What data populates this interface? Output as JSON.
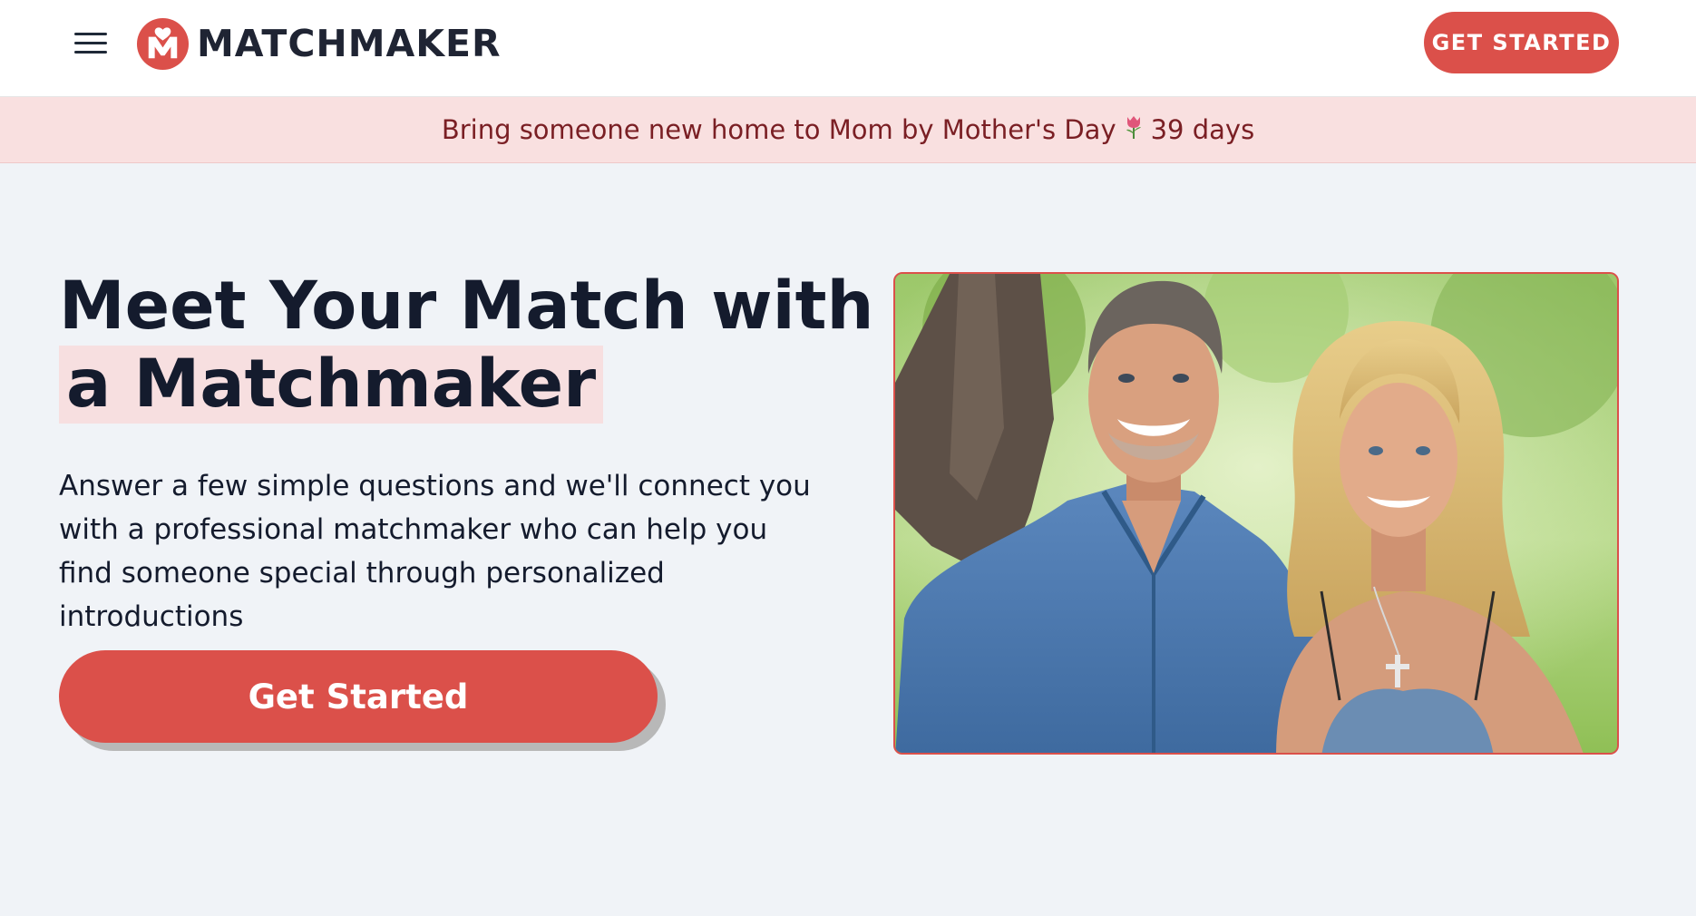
{
  "header": {
    "menu_icon": "hamburger-menu-icon",
    "logo_icon": "matchmaker-heart-m-logo",
    "logo_text": "MATCHMAKER",
    "cta_label": "GET STARTED"
  },
  "banner": {
    "text": "Bring someone new home to Mom by Mother's Day",
    "icon": "tulip-icon",
    "countdown": "39 days"
  },
  "hero": {
    "title_line1": "Meet Your Match with",
    "title_line2": "a Matchmaker",
    "description": "Answer a few simple questions and we'll connect you with a professional matchmaker who can help you find someone special through personalized introductions",
    "cta_label": "Get Started",
    "image_subject": "smiling couple outdoors"
  },
  "colors": {
    "accent": "#db504a",
    "banner_bg": "#f9e0e0",
    "banner_text": "#7a1f24",
    "page_bg": "#f0f3f7",
    "heading": "#141b2d",
    "highlight": "#f7dfe0"
  }
}
